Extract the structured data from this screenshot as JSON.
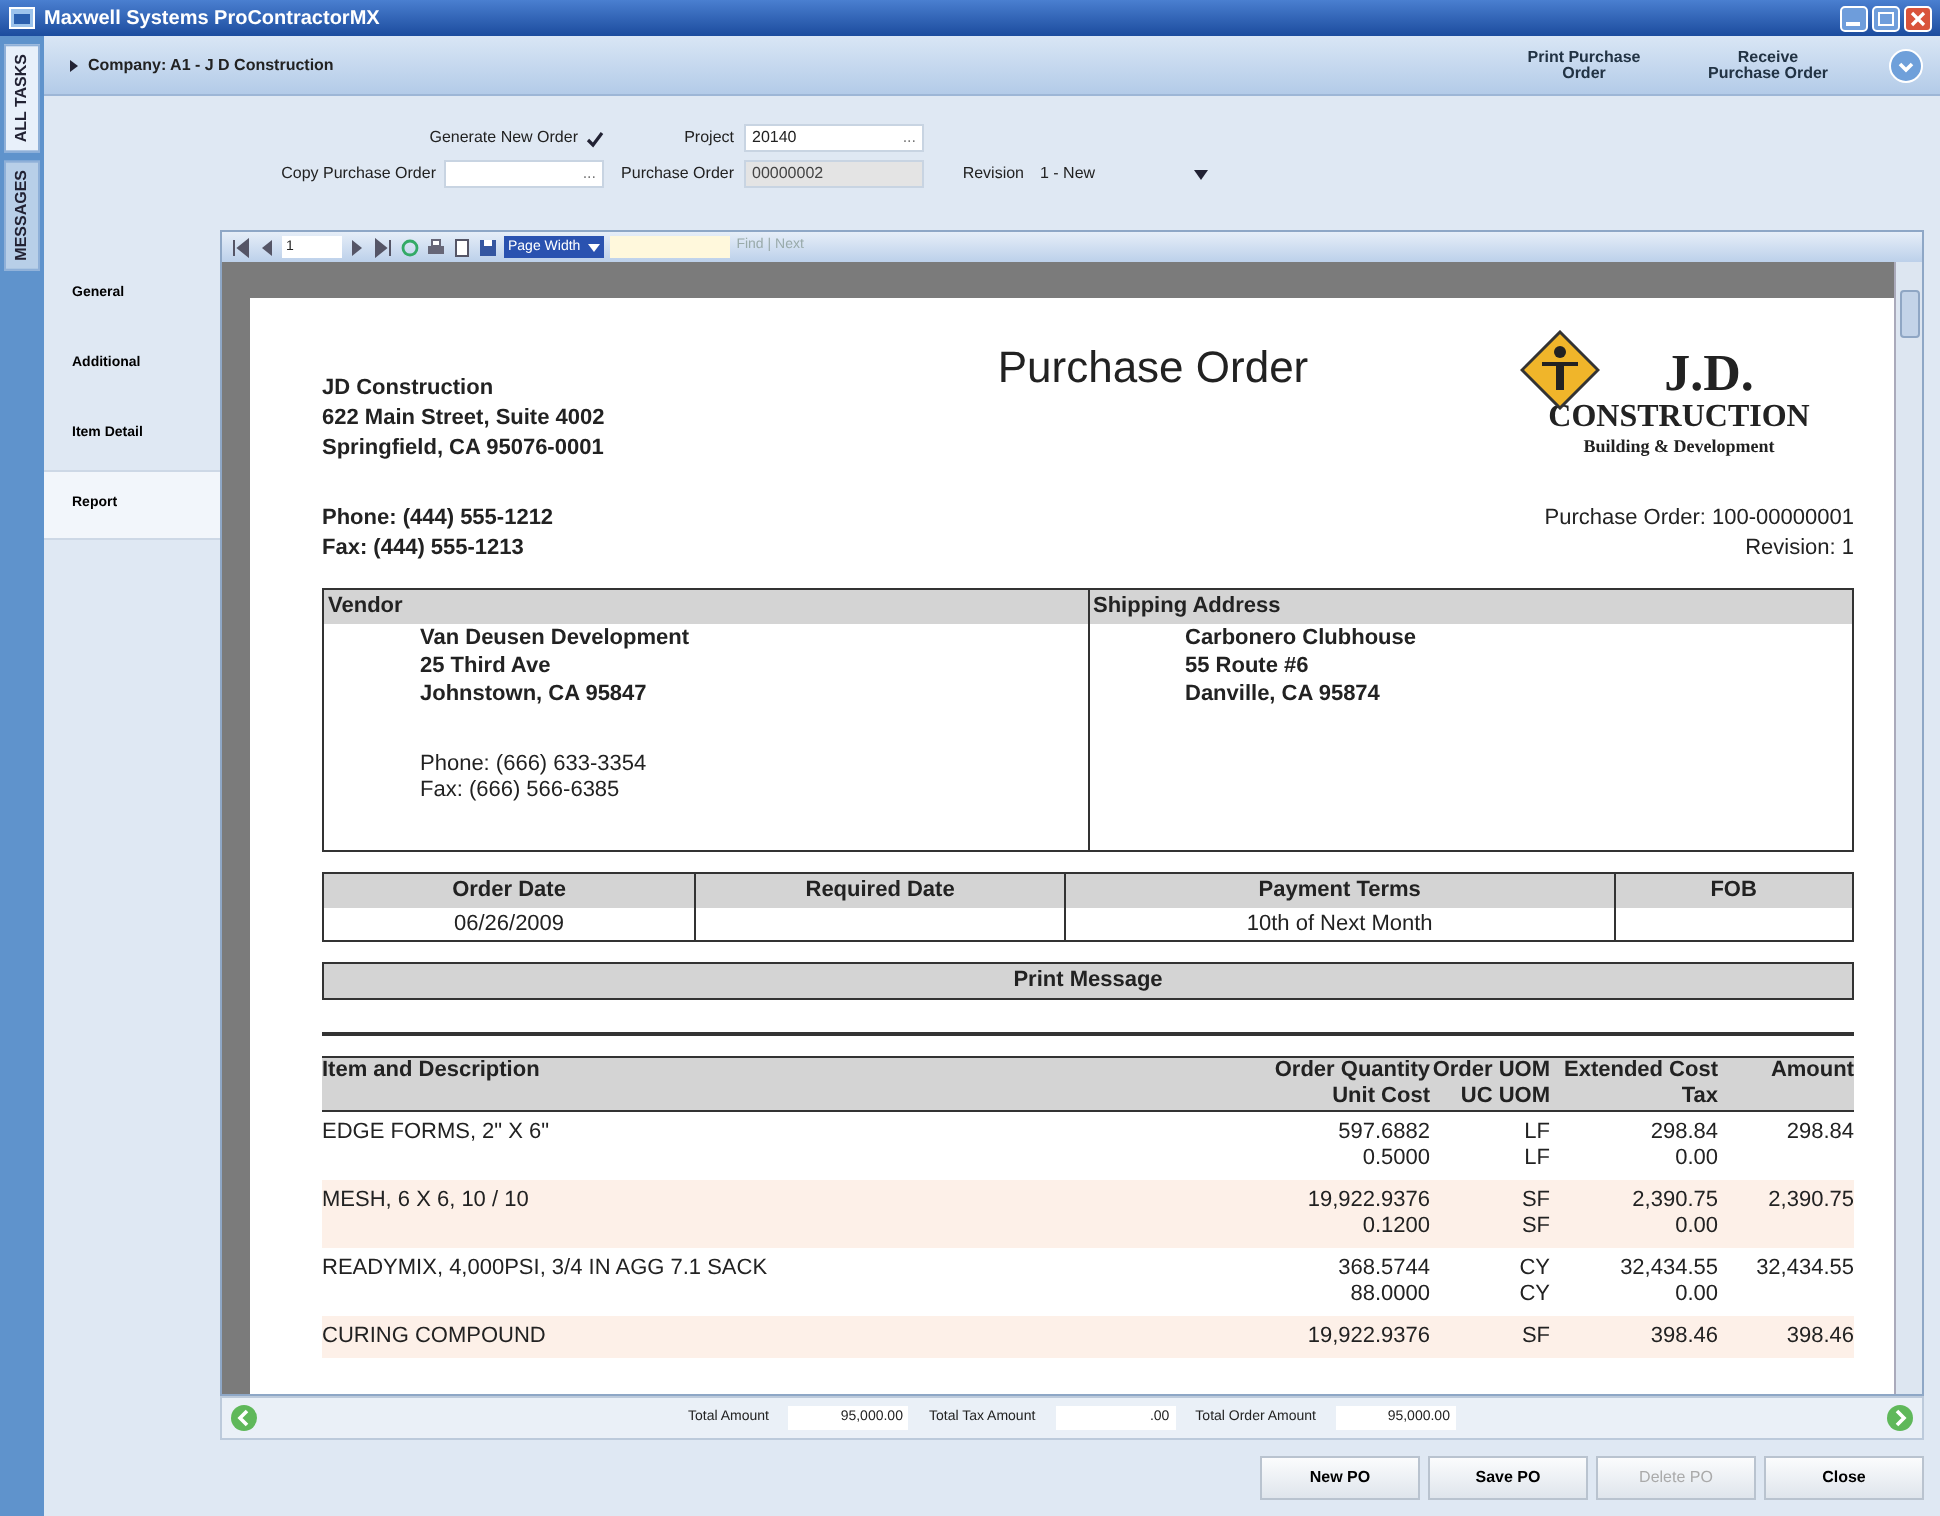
{
  "window": {
    "title": "Maxwell Systems ProContractorMX"
  },
  "vertical_tabs": [
    {
      "label": "ALL TASKS",
      "selected": true
    },
    {
      "label": "MESSAGES",
      "selected": false
    }
  ],
  "header": {
    "company": "Company: A1 - J D Construction",
    "actions": [
      "Print Purchase Order",
      "Receive Purchase Order"
    ]
  },
  "form": {
    "generate_new_order": {
      "label": "Generate New Order",
      "checked": true
    },
    "copy_purchase_order": {
      "label": "Copy Purchase Order",
      "button": "..."
    },
    "project": {
      "label": "Project",
      "value": "20140",
      "button": "..."
    },
    "purchase_order": {
      "label": "Purchase Order",
      "value": "00000002",
      "disabled": true
    },
    "revision": {
      "label": "Revision",
      "value": "1 - New"
    }
  },
  "nav": [
    {
      "label": "General",
      "selected": false
    },
    {
      "label": "Additional",
      "selected": false
    },
    {
      "label": "Item Detail",
      "selected": false
    },
    {
      "label": "Report",
      "selected": true
    }
  ],
  "viewer": {
    "toolbar": {
      "page": "1",
      "zoom": "Page Width",
      "find": "Find | Next"
    },
    "report": {
      "company_address": [
        "JD Construction",
        "622 Main Street, Suite 4002",
        "Springfield, CA 95076-0001"
      ],
      "title": "Purchase Order",
      "logo": {
        "mark": "J.D.",
        "name": "CONSTRUCTION",
        "tagline": "Building & Development"
      },
      "contact": [
        "Phone: (444) 555-1212",
        "Fax: (444) 555-1213"
      ],
      "po_number": "Purchase Order: 100-00000001",
      "revision": "Revision: 1",
      "vendor": {
        "heading": "Vendor",
        "lines": [
          "Van Deusen Development",
          "25 Third Ave",
          "Johnstown, CA  95847"
        ],
        "contact": [
          "Phone: (666) 633-3354",
          "Fax: (666) 566-6385"
        ]
      },
      "shipping": {
        "heading": "Shipping Address",
        "lines": [
          "Carbonero Clubhouse",
          "55 Route #6",
          "Danville, CA  95874"
        ]
      },
      "terms": [
        {
          "heading": "Order Date",
          "value": "06/26/2009"
        },
        {
          "heading": "Required Date"
        },
        {
          "heading": "Payment Terms",
          "value": "10th of Next Month"
        },
        {
          "heading": "FOB"
        }
      ],
      "print_message": "Print Message",
      "items": {
        "columns": [
          {
            "top": "Item and Description"
          },
          {
            "top": "Order Quantity",
            "bottom": "Unit Cost"
          },
          {
            "top": "Order UOM",
            "bottom": "UC UOM"
          },
          {
            "top": "Extended Cost",
            "bottom": "Tax"
          },
          {
            "top": "Amount"
          }
        ],
        "rows": [
          {
            "cells": [
              [
                "EDGE FORMS, 2\" X 6\""
              ],
              [
                "597.6882",
                "0.5000"
              ],
              [
                "LF",
                "LF"
              ],
              [
                "298.84",
                "0.00"
              ],
              [
                "298.84"
              ]
            ]
          },
          {
            "cells": [
              [
                "MESH, 6 X 6, 10 / 10"
              ],
              [
                "19,922.9376",
                "0.1200"
              ],
              [
                "SF",
                "SF"
              ],
              [
                "2,390.75",
                "0.00"
              ],
              [
                "2,390.75"
              ]
            ]
          },
          {
            "cells": [
              [
                "READYMIX, 4,000PSI, 3/4 IN AGG 7.1 SACK"
              ],
              [
                "368.5744",
                "88.0000"
              ],
              [
                "CY",
                "CY"
              ],
              [
                "32,434.55",
                "0.00"
              ],
              [
                "32,434.55"
              ]
            ]
          },
          {
            "cells": [
              [
                "CURING COMPOUND"
              ],
              [
                "19,922.9376"
              ],
              [
                "SF"
              ],
              [
                "398.46"
              ],
              [
                "398.46"
              ]
            ]
          }
        ]
      }
    }
  },
  "totals": [
    {
      "label": "Total Amount",
      "value": "95,000.00"
    },
    {
      "label": "Total Tax Amount",
      "value": ".00"
    },
    {
      "label": "Total Order Amount",
      "value": "95,000.00"
    }
  ],
  "buttons": [
    {
      "label": "New PO",
      "disabled": false
    },
    {
      "label": "Save PO",
      "disabled": false
    },
    {
      "label": "Delete PO",
      "disabled": true
    },
    {
      "label": "Close",
      "disabled": false
    }
  ]
}
